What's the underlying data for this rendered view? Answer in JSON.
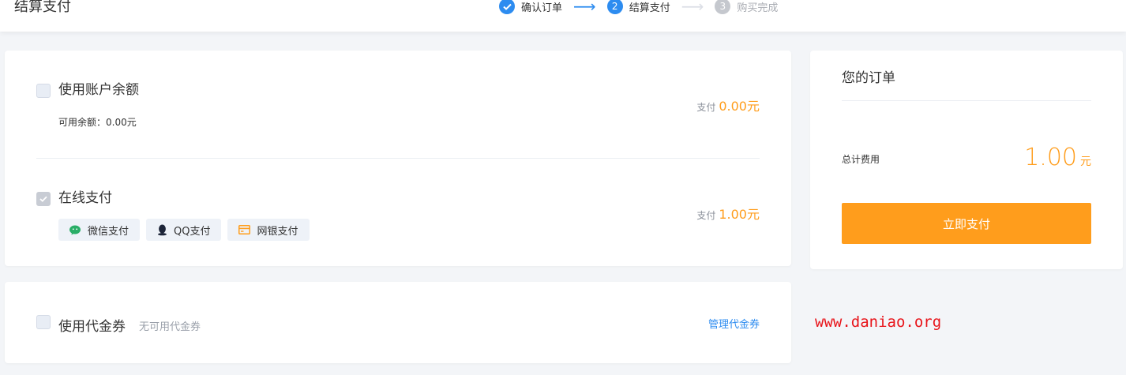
{
  "header": {
    "title": "结算支付",
    "steps": [
      {
        "number": "",
        "label": "确认订单",
        "state": "done"
      },
      {
        "number": "2",
        "label": "结算支付",
        "state": "active"
      },
      {
        "number": "3",
        "label": "购买完成",
        "state": "todo"
      }
    ]
  },
  "payment": {
    "balance": {
      "title": "使用账户余额",
      "available": "可用余额：0.00元",
      "pay_label": "支付",
      "pay_amount": "0.00元",
      "checked": false
    },
    "online": {
      "title": "在线支付",
      "pay_label": "支付",
      "pay_amount": "1.00元",
      "checked": true,
      "methods": [
        {
          "label": "微信支付",
          "icon": "wechat-icon"
        },
        {
          "label": "QQ支付",
          "icon": "qq-icon"
        },
        {
          "label": "网银支付",
          "icon": "bank-card-icon"
        }
      ]
    }
  },
  "coupon": {
    "title": "使用代金券",
    "status": "无可用代金券",
    "manage_link": "管理代金券",
    "checked": false
  },
  "order": {
    "title": "您的订单",
    "total_label": "总计费用",
    "total_value": "1.00",
    "total_unit": "元",
    "pay_button": "立即支付"
  },
  "watermark": "www.daniao.org",
  "colors": {
    "accent": "#ff9d1c",
    "primary_blue": "#2d8cf0",
    "watermark_red": "#e8141a"
  }
}
